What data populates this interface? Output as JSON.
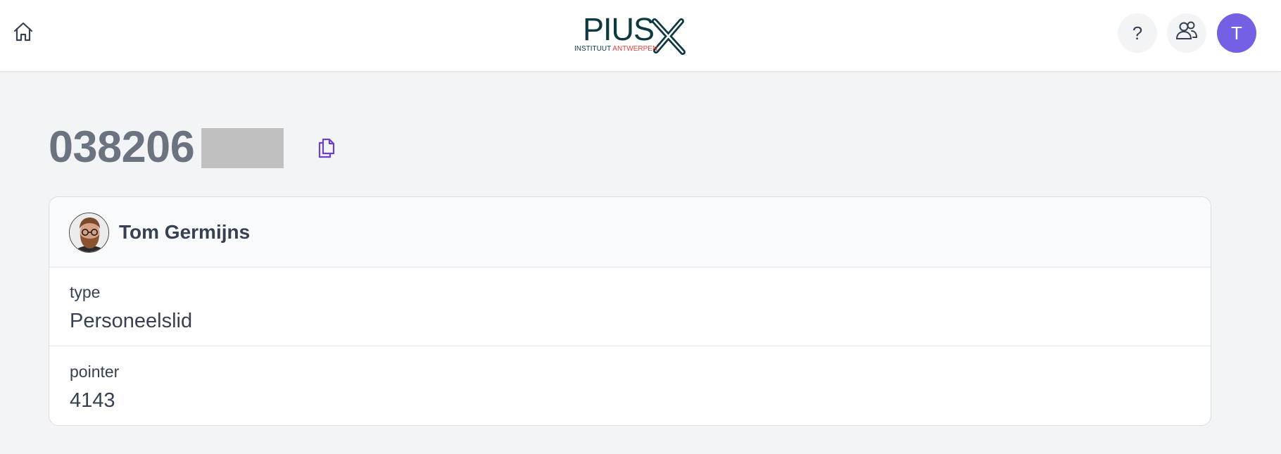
{
  "header": {
    "home_icon": "home-icon",
    "logo": {
      "word": "PIUS",
      "mark": "X",
      "sub_dark": "INSTITUUT",
      "sub_red": "ANTWERPEN"
    },
    "help_label": "?",
    "users_icon": "users-icon",
    "avatar_initial": "T",
    "colors": {
      "avatar": "#7360e4",
      "logo_dark": "#0e3940",
      "logo_red": "#e2403a"
    }
  },
  "page": {
    "title": "038206",
    "copy_icon": "copy-icon",
    "copy_icon_color": "#6d3fd0"
  },
  "card": {
    "name": "Tom Germijns",
    "fields": [
      {
        "label": "type",
        "value": "Personeelslid"
      },
      {
        "label": "pointer",
        "value": "4143"
      }
    ]
  }
}
